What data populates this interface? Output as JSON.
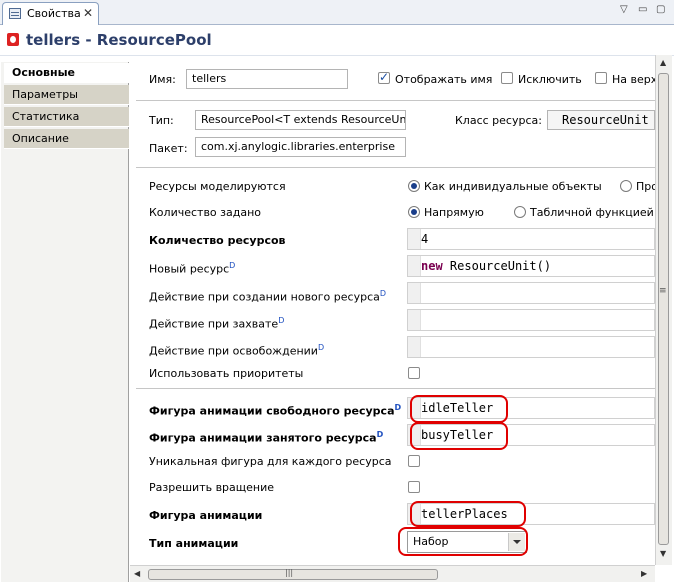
{
  "tab": {
    "title": "Свойства",
    "close": "✕"
  },
  "window_buttons": {
    "menu": "▽",
    "minimize": "▭",
    "maximize": "▢"
  },
  "header": {
    "title": "tellers - ResourcePool"
  },
  "sidebar": {
    "items": [
      {
        "label": "Основные"
      },
      {
        "label": "Параметры"
      },
      {
        "label": "Статистика"
      },
      {
        "label": "Описание"
      }
    ]
  },
  "general": {
    "name_label": "Имя:",
    "name_value": "tellers",
    "show_name_label": "Отображать имя",
    "exclude_label": "Исключить",
    "on_top_label": "На верх",
    "type_label": "Тип:",
    "type_value": "ResourcePool<T extends ResourceUnit",
    "resource_class_label": "Класс ресурса:",
    "resource_class_value": "ResourceUnit",
    "package_label": "Пакет:",
    "package_value": "com.xj.anylogic.libraries.enterprise"
  },
  "params": {
    "modeled_label": "Ресурсы моделируются",
    "opt_individual": "Как индивидуальные объекты",
    "opt_pro": "Про",
    "qty_given_label": "Количество задано",
    "opt_direct": "Напрямую",
    "opt_table": "Табличной функцией",
    "resource_count_label": "Количество ресурсов",
    "resource_count_value": "4",
    "new_resource_label": "Новый ресурс",
    "new_kw": "new",
    "new_resource_value": "ResourceUnit()",
    "on_create_label": "Действие при создании нового ресурса",
    "on_seize_label": "Действие при захвате",
    "on_release_label": "Действие при освобождении",
    "use_priorities_label": "Использовать приоритеты",
    "idle_shape_label": "Фигура анимации свободного ресурса",
    "idle_shape_value": "idleTeller",
    "busy_shape_label": "Фигура анимации занятого ресурса",
    "busy_shape_value": "busyTeller",
    "unique_shape_label": "Уникальная фигура для каждого ресурса",
    "allow_rotation_label": "Разрешить вращение",
    "anim_shape_label": "Фигура анимации",
    "anim_shape_value": "tellerPlaces",
    "anim_type_label": "Тип анимации",
    "anim_type_value": "Набор",
    "dyn_marker": "D"
  },
  "scroll": {
    "up": "▲",
    "down": "▼",
    "left": "◀",
    "right": "▶",
    "grip": "≡",
    "hgrip": "|||"
  }
}
